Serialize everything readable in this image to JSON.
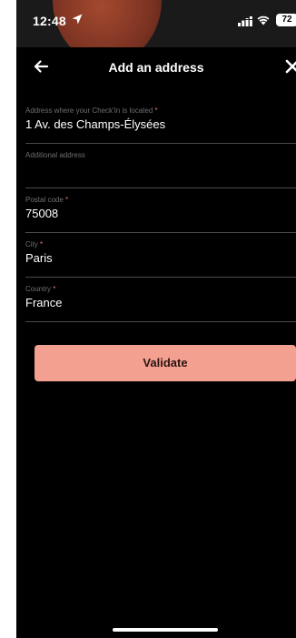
{
  "status_bar": {
    "time": "12:48",
    "battery": "72"
  },
  "nav": {
    "title": "Add an address"
  },
  "form": {
    "fields": [
      {
        "label": "Address where your Check'In is located",
        "required_mark": "*",
        "value": "1 Av. des Champs-Élysées"
      },
      {
        "label": "Additional address",
        "required_mark": "",
        "value": ""
      },
      {
        "label": "Postal code",
        "required_mark": "*",
        "value": "75008"
      },
      {
        "label": "City",
        "required_mark": "*",
        "value": "Paris"
      },
      {
        "label": "Country",
        "required_mark": "*",
        "value": "France"
      }
    ]
  },
  "actions": {
    "validate_label": "Validate"
  },
  "colors": {
    "background": "#000000",
    "accent_button": "#f4a091",
    "required_mark": "#f0706a",
    "label_text": "#6f6f6f",
    "divider": "#4a4a4a"
  },
  "icons": {
    "back": "arrow-left-icon",
    "close": "close-icon",
    "location": "location-arrow-icon",
    "signal": "signal-icon",
    "wifi": "wifi-icon",
    "battery": "battery-icon"
  }
}
